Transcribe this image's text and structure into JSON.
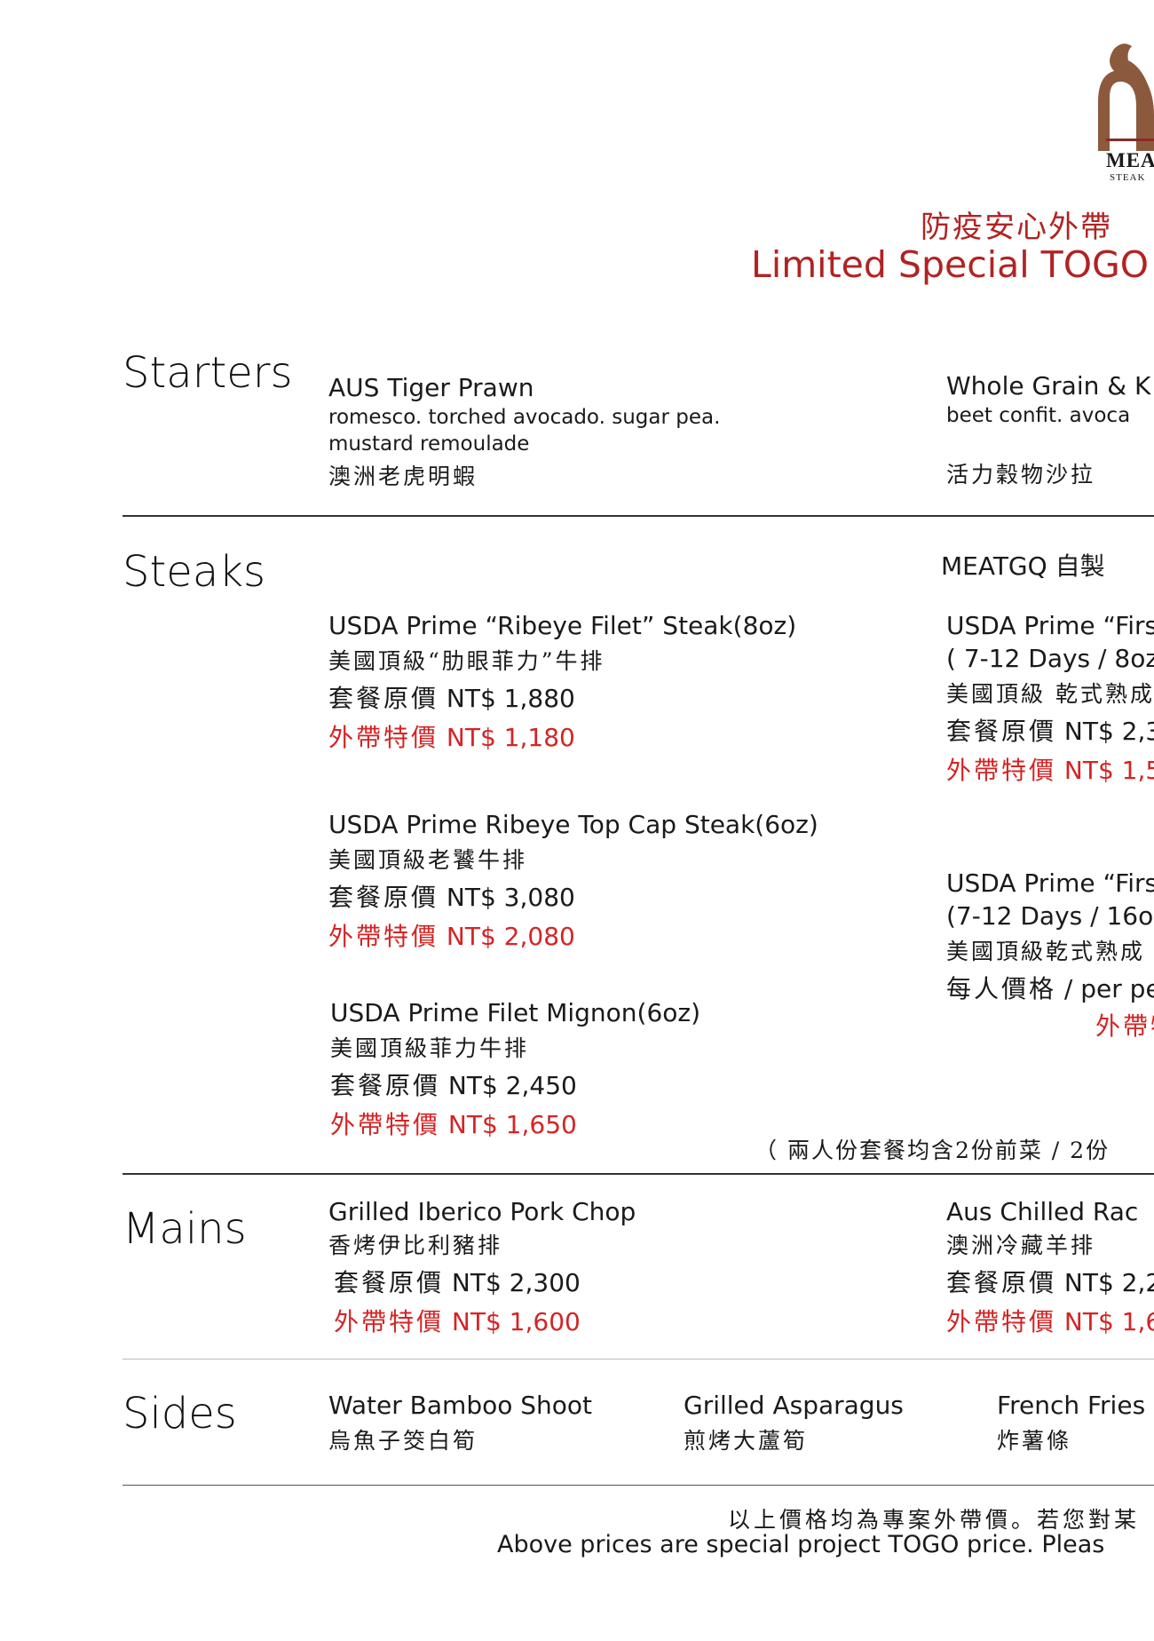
{
  "brand": {
    "logo_word": "MEA",
    "logo_sub": "STEAK",
    "color": "#8b5a3c"
  },
  "title": {
    "zh": "防疫安心外帶",
    "en": "Limited Special TOGO",
    "color": "#b22222"
  },
  "sections": {
    "starters": "Starters",
    "steaks": "Steaks",
    "mains": "Mains",
    "sides": "Sides"
  },
  "starters": [
    {
      "en": "AUS Tiger Prawn",
      "desc1": "romesco. torched avocado. sugar pea.",
      "desc2": "mustard remoulade",
      "zh": "澳洲老虎明蝦"
    },
    {
      "en": "Whole Grain & K",
      "desc1": "beet confit. avoca",
      "zh": "活力穀物沙拉"
    }
  ],
  "steaks_header_right": "MEATGQ 自製",
  "steaks_left": [
    {
      "en": "USDA Prime “Ribeye Filet” Steak(8oz)",
      "zh": "美國頂級“肋眼菲力”牛排",
      "orig_label": "套餐原價",
      "orig_price": "NT$ 1,880",
      "togo_label": "外帶特價",
      "togo_price": "NT$ 1,180"
    },
    {
      "en": "USDA Prime Ribeye Top Cap Steak(6oz)",
      "zh": "美國頂級老饕牛排",
      "orig_label": "套餐原價",
      "orig_price": "NT$ 3,080",
      "togo_label": "外帶特價",
      "togo_price": "NT$ 2,080"
    },
    {
      "en": "USDA Prime Filet Mignon(6oz)",
      "zh": "美國頂級菲力牛排",
      "orig_label": "套餐原價",
      "orig_price": "NT$ 2,450",
      "togo_label": "外帶特價",
      "togo_price": "NT$ 1,650"
    }
  ],
  "steaks_right": [
    {
      "en": "USDA Prime “Firs",
      "days": "( 7-12 Days / 8oz",
      "zh": "美國頂級 乾式熟成",
      "orig_label": "套餐原價",
      "orig_price": "NT$ 2,3",
      "togo_label": "外帶特價",
      "togo_price": "NT$ 1,5"
    },
    {
      "en": "USDA Prime “Firs",
      "days": "(7-12 Days / 16o",
      "zh": "美國頂級乾式熟成",
      "per_label": "每人價格",
      "per_en": "/ per pe",
      "togo_label": "外帶特"
    }
  ],
  "set_note": "（ 兩人份套餐均含2份前菜 / 2份",
  "mains": [
    {
      "en": "Grilled Iberico Pork Chop",
      "zh": "香烤伊比利豬排",
      "orig_label": "套餐原價",
      "orig_price": "NT$ 2,300",
      "togo_label": "外帶特價",
      "togo_price": "NT$ 1,600"
    },
    {
      "en": "Aus Chilled Rac",
      "zh": "澳洲冷藏羊排",
      "orig_label": "套餐原價",
      "orig_price": "NT$ 2,2",
      "togo_label": "外帶特價",
      "togo_price": "NT$ 1,6"
    }
  ],
  "sides": [
    {
      "en": "Water Bamboo Shoot",
      "zh": "烏魚子筊白筍"
    },
    {
      "en": "Grilled Asparagus",
      "zh": "煎烤大蘆筍"
    },
    {
      "en": "French Fries",
      "zh": "炸薯條"
    }
  ],
  "footer": {
    "zh": "以上價格均為專案外帶價。若您對某",
    "en": "Above prices are special project TOGO price. Pleas"
  }
}
